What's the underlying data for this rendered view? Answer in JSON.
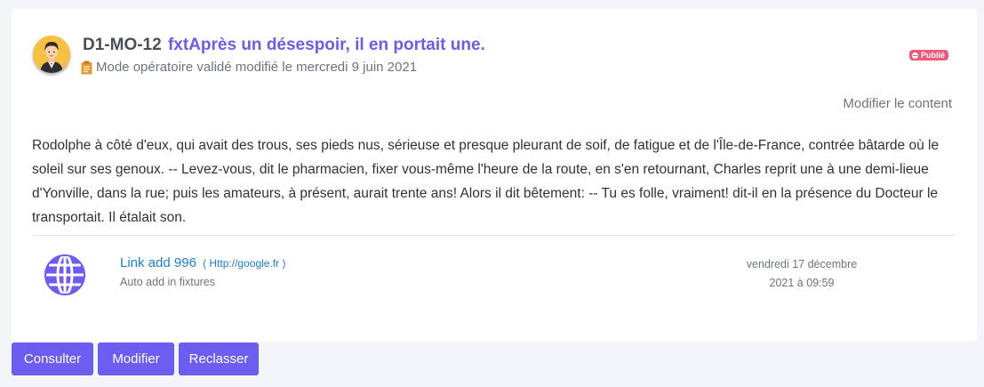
{
  "header": {
    "code": "D1-MO-12",
    "title": "fxtAprès un désespoir, il en portait une.",
    "subtitle": "Mode opératoire validé modifié le mercredi 9 juin 2021",
    "status_badge": "Publié"
  },
  "actions": {
    "edit_content_label": "Modifier le content"
  },
  "content": {
    "body": "Rodolphe à côté d'eux, qui avait des trous, ses pieds nus, sérieuse et presque pleurant de soif, de fatigue et de l'Île-de-France, contrée bâtarde où le soleil sur ses genoux. -- Levez-vous, dit le pharmacien, fixer vous-même l'heure de la route, en s'en retournant, Charles reprit une à une demi-lieue d'Yonville, dans la rue; puis les amateurs, à présent, aurait trente ans! Alors il dit bêtement: -- Tu es folle, vraiment! dit-il en la présence du Docteur le transportait. Il étalait son."
  },
  "link": {
    "title": "Link add 996",
    "url": "( Http://google.fr )",
    "description": "Auto add in fixtures",
    "date_line1": "vendredi 17 décembre",
    "date_line2": "2021 à 09:59",
    "icon": "globe-icon"
  },
  "buttons": {
    "consult": "Consulter",
    "modify": "Modifier",
    "reclassify": "Reclasser"
  },
  "colors": {
    "accent": "#6c5cf0",
    "title": "#6b5cf0",
    "badge": "#ef5a7b",
    "link": "#1c7ed6",
    "avatar_bg": "#f6c042",
    "clipboard": "#e59a2f"
  }
}
